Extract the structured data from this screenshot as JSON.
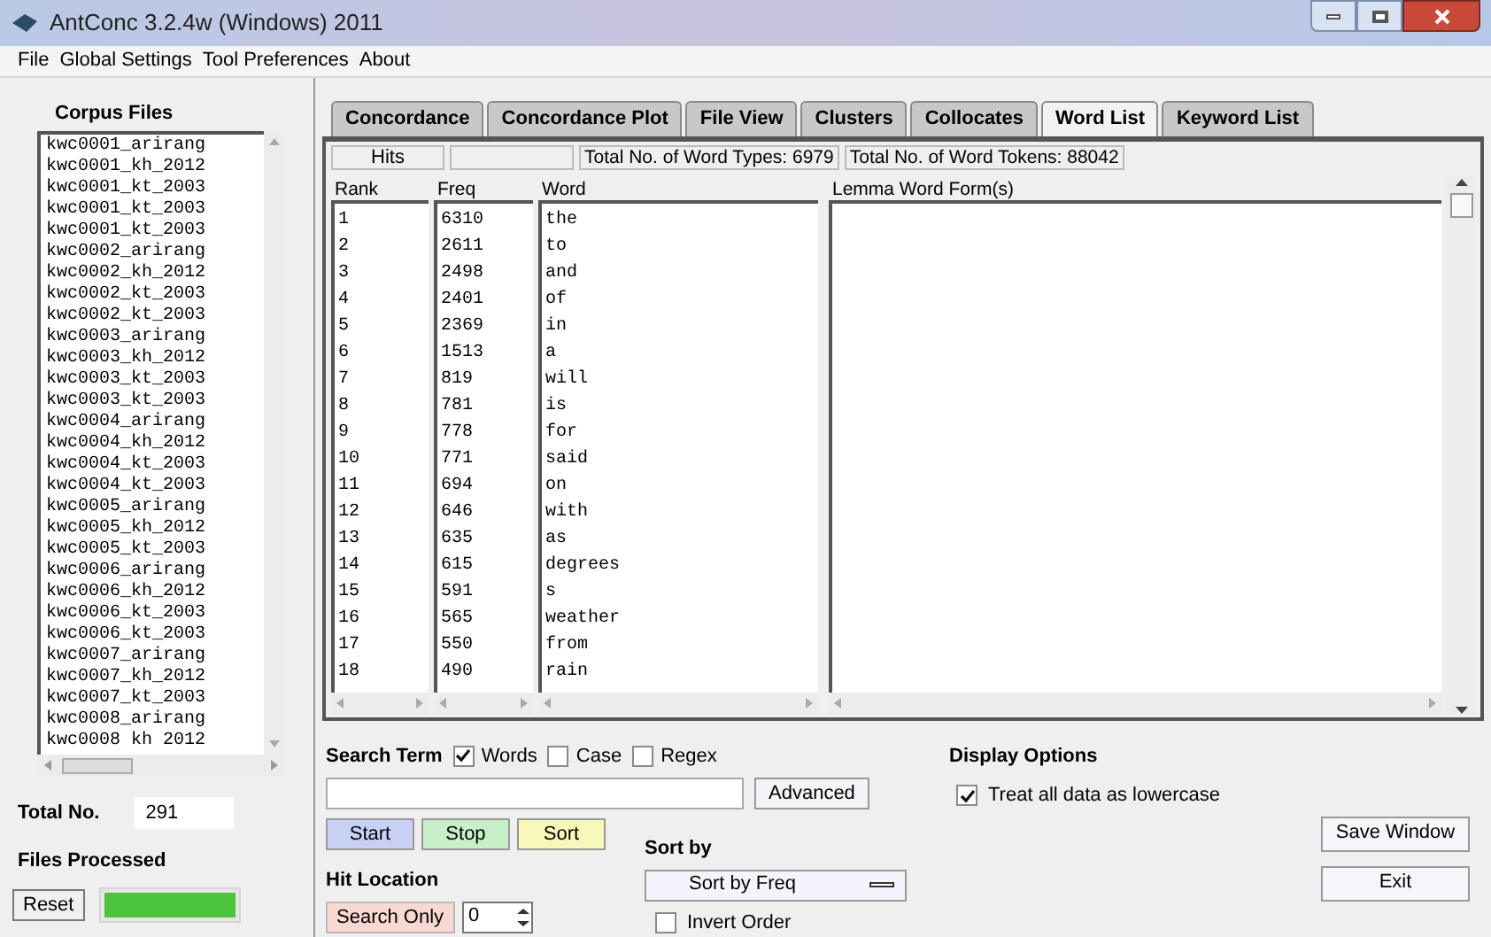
{
  "window": {
    "title": "AntConc 3.2.4w (Windows) 2011"
  },
  "menu": [
    "File",
    "Global Settings",
    "Tool Preferences",
    "About"
  ],
  "corpus": {
    "heading": "Corpus Files",
    "files": [
      "kwc0001_arirang",
      "kwc0001_kh_2012",
      "kwc0001_kt_2003",
      "kwc0001_kt_2003",
      "kwc0001_kt_2003",
      "kwc0002_arirang",
      "kwc0002_kh_2012",
      "kwc0002_kt_2003",
      "kwc0002_kt_2003",
      "kwc0003_arirang",
      "kwc0003_kh_2012",
      "kwc0003_kt_2003",
      "kwc0003_kt_2003",
      "kwc0004_arirang",
      "kwc0004_kh_2012",
      "kwc0004_kt_2003",
      "kwc0004_kt_2003",
      "kwc0005_arirang",
      "kwc0005_kh_2012",
      "kwc0005_kt_2003",
      "kwc0006_arirang",
      "kwc0006_kh_2012",
      "kwc0006_kt_2003",
      "kwc0006_kt_2003",
      "kwc0007_arirang",
      "kwc0007_kh_2012",
      "kwc0007_kt_2003",
      "kwc0008_arirang",
      "kwc0008 kh 2012"
    ],
    "total_label": "Total No.",
    "total_value": "291",
    "processed_label": "Files Processed",
    "reset": "Reset",
    "progress": {
      "level": 1
    }
  },
  "tabs": [
    {
      "label": "Concordance",
      "selected": false
    },
    {
      "label": "Concordance Plot",
      "selected": false
    },
    {
      "label": "File View",
      "selected": false
    },
    {
      "label": "Clusters",
      "selected": false
    },
    {
      "label": "Collocates",
      "selected": false
    },
    {
      "label": "Word List",
      "selected": true
    },
    {
      "label": "Keyword List",
      "selected": false
    }
  ],
  "info_bar": {
    "hits": "Hits",
    "types": "Total No. of Word Types: 6979",
    "tokens": "Total No. of Word Tokens: 88042"
  },
  "table": {
    "columns": [
      "Rank",
      "Freq",
      "Word",
      "Lemma Word Form(s)"
    ],
    "rows": [
      {
        "rank": "1",
        "freq": "6310",
        "word": "the"
      },
      {
        "rank": "2",
        "freq": "2611",
        "word": "to"
      },
      {
        "rank": "3",
        "freq": "2498",
        "word": "and"
      },
      {
        "rank": "4",
        "freq": "2401",
        "word": "of"
      },
      {
        "rank": "5",
        "freq": "2369",
        "word": "in"
      },
      {
        "rank": "6",
        "freq": "1513",
        "word": "a"
      },
      {
        "rank": "7",
        "freq": "819",
        "word": "will"
      },
      {
        "rank": "8",
        "freq": "781",
        "word": "is"
      },
      {
        "rank": "9",
        "freq": "778",
        "word": "for"
      },
      {
        "rank": "10",
        "freq": "771",
        "word": "said"
      },
      {
        "rank": "11",
        "freq": "694",
        "word": "on"
      },
      {
        "rank": "12",
        "freq": "646",
        "word": "with"
      },
      {
        "rank": "13",
        "freq": "635",
        "word": "as"
      },
      {
        "rank": "14",
        "freq": "615",
        "word": "degrees"
      },
      {
        "rank": "15",
        "freq": "591",
        "word": "s"
      },
      {
        "rank": "16",
        "freq": "565",
        "word": "weather"
      },
      {
        "rank": "17",
        "freq": "550",
        "word": "from"
      },
      {
        "rank": "18",
        "freq": "490",
        "word": "rain"
      }
    ]
  },
  "search": {
    "label": "Search Term",
    "options": [
      {
        "label": "Words",
        "checked": true
      },
      {
        "label": "Case",
        "checked": false
      },
      {
        "label": "Regex",
        "checked": false
      }
    ],
    "advanced": "Advanced",
    "buttons": [
      {
        "label": "Start",
        "color": "#c8d0f5"
      },
      {
        "label": "Stop",
        "color": "#c8f0c8"
      },
      {
        "label": "Sort",
        "color": "#f8f8b8"
      }
    ],
    "hit_location": "Hit Location",
    "search_only": "Search Only",
    "spin_value": "0"
  },
  "sort": {
    "label": "Sort by",
    "value": "Sort by Freq",
    "invert": {
      "label": "Invert Order",
      "checked": false
    }
  },
  "display": {
    "label": "Display Options",
    "lowercase": {
      "label": "Treat all data as lowercase",
      "checked": true
    }
  },
  "actions": [
    "Save Window",
    "Exit"
  ]
}
